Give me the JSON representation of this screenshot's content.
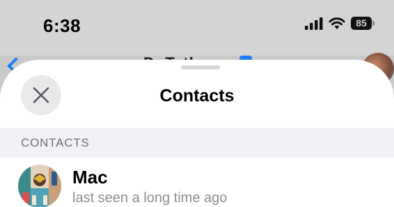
{
  "status_bar": {
    "time": "6:38",
    "battery": "85"
  },
  "background_header": {
    "title_fragment": "DoTath"
  },
  "sheet": {
    "title": "Contacts",
    "section_header": "CONTACTS",
    "contacts": [
      {
        "name": "Mac",
        "status": "last seen a long time ago"
      }
    ]
  },
  "colors": {
    "accent": "#1e7cf2",
    "secondary_text": "#8e8e93",
    "section_bg": "#f2f2f6"
  },
  "icons": {
    "close": "close-icon",
    "signal": "cellular-signal-icon",
    "wifi": "wifi-icon",
    "battery": "battery-icon"
  }
}
